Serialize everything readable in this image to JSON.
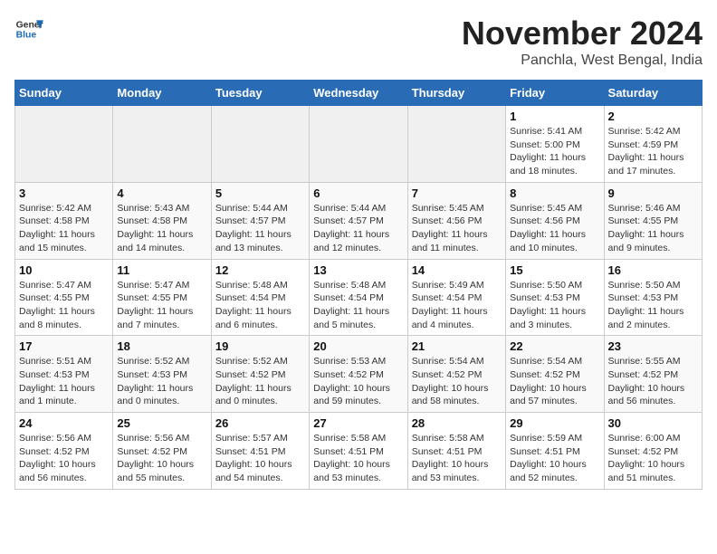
{
  "header": {
    "logo_line1": "General",
    "logo_line2": "Blue",
    "title": "November 2024",
    "subtitle": "Panchla, West Bengal, India"
  },
  "weekdays": [
    "Sunday",
    "Monday",
    "Tuesday",
    "Wednesday",
    "Thursday",
    "Friday",
    "Saturday"
  ],
  "weeks": [
    [
      {
        "day": "",
        "info": ""
      },
      {
        "day": "",
        "info": ""
      },
      {
        "day": "",
        "info": ""
      },
      {
        "day": "",
        "info": ""
      },
      {
        "day": "",
        "info": ""
      },
      {
        "day": "1",
        "info": "Sunrise: 5:41 AM\nSunset: 5:00 PM\nDaylight: 11 hours and 18 minutes."
      },
      {
        "day": "2",
        "info": "Sunrise: 5:42 AM\nSunset: 4:59 PM\nDaylight: 11 hours and 17 minutes."
      }
    ],
    [
      {
        "day": "3",
        "info": "Sunrise: 5:42 AM\nSunset: 4:58 PM\nDaylight: 11 hours and 15 minutes."
      },
      {
        "day": "4",
        "info": "Sunrise: 5:43 AM\nSunset: 4:58 PM\nDaylight: 11 hours and 14 minutes."
      },
      {
        "day": "5",
        "info": "Sunrise: 5:44 AM\nSunset: 4:57 PM\nDaylight: 11 hours and 13 minutes."
      },
      {
        "day": "6",
        "info": "Sunrise: 5:44 AM\nSunset: 4:57 PM\nDaylight: 11 hours and 12 minutes."
      },
      {
        "day": "7",
        "info": "Sunrise: 5:45 AM\nSunset: 4:56 PM\nDaylight: 11 hours and 11 minutes."
      },
      {
        "day": "8",
        "info": "Sunrise: 5:45 AM\nSunset: 4:56 PM\nDaylight: 11 hours and 10 minutes."
      },
      {
        "day": "9",
        "info": "Sunrise: 5:46 AM\nSunset: 4:55 PM\nDaylight: 11 hours and 9 minutes."
      }
    ],
    [
      {
        "day": "10",
        "info": "Sunrise: 5:47 AM\nSunset: 4:55 PM\nDaylight: 11 hours and 8 minutes."
      },
      {
        "day": "11",
        "info": "Sunrise: 5:47 AM\nSunset: 4:55 PM\nDaylight: 11 hours and 7 minutes."
      },
      {
        "day": "12",
        "info": "Sunrise: 5:48 AM\nSunset: 4:54 PM\nDaylight: 11 hours and 6 minutes."
      },
      {
        "day": "13",
        "info": "Sunrise: 5:48 AM\nSunset: 4:54 PM\nDaylight: 11 hours and 5 minutes."
      },
      {
        "day": "14",
        "info": "Sunrise: 5:49 AM\nSunset: 4:54 PM\nDaylight: 11 hours and 4 minutes."
      },
      {
        "day": "15",
        "info": "Sunrise: 5:50 AM\nSunset: 4:53 PM\nDaylight: 11 hours and 3 minutes."
      },
      {
        "day": "16",
        "info": "Sunrise: 5:50 AM\nSunset: 4:53 PM\nDaylight: 11 hours and 2 minutes."
      }
    ],
    [
      {
        "day": "17",
        "info": "Sunrise: 5:51 AM\nSunset: 4:53 PM\nDaylight: 11 hours and 1 minute."
      },
      {
        "day": "18",
        "info": "Sunrise: 5:52 AM\nSunset: 4:53 PM\nDaylight: 11 hours and 0 minutes."
      },
      {
        "day": "19",
        "info": "Sunrise: 5:52 AM\nSunset: 4:52 PM\nDaylight: 11 hours and 0 minutes."
      },
      {
        "day": "20",
        "info": "Sunrise: 5:53 AM\nSunset: 4:52 PM\nDaylight: 10 hours and 59 minutes."
      },
      {
        "day": "21",
        "info": "Sunrise: 5:54 AM\nSunset: 4:52 PM\nDaylight: 10 hours and 58 minutes."
      },
      {
        "day": "22",
        "info": "Sunrise: 5:54 AM\nSunset: 4:52 PM\nDaylight: 10 hours and 57 minutes."
      },
      {
        "day": "23",
        "info": "Sunrise: 5:55 AM\nSunset: 4:52 PM\nDaylight: 10 hours and 56 minutes."
      }
    ],
    [
      {
        "day": "24",
        "info": "Sunrise: 5:56 AM\nSunset: 4:52 PM\nDaylight: 10 hours and 56 minutes."
      },
      {
        "day": "25",
        "info": "Sunrise: 5:56 AM\nSunset: 4:52 PM\nDaylight: 10 hours and 55 minutes."
      },
      {
        "day": "26",
        "info": "Sunrise: 5:57 AM\nSunset: 4:51 PM\nDaylight: 10 hours and 54 minutes."
      },
      {
        "day": "27",
        "info": "Sunrise: 5:58 AM\nSunset: 4:51 PM\nDaylight: 10 hours and 53 minutes."
      },
      {
        "day": "28",
        "info": "Sunrise: 5:58 AM\nSunset: 4:51 PM\nDaylight: 10 hours and 53 minutes."
      },
      {
        "day": "29",
        "info": "Sunrise: 5:59 AM\nSunset: 4:51 PM\nDaylight: 10 hours and 52 minutes."
      },
      {
        "day": "30",
        "info": "Sunrise: 6:00 AM\nSunset: 4:52 PM\nDaylight: 10 hours and 51 minutes."
      }
    ]
  ]
}
